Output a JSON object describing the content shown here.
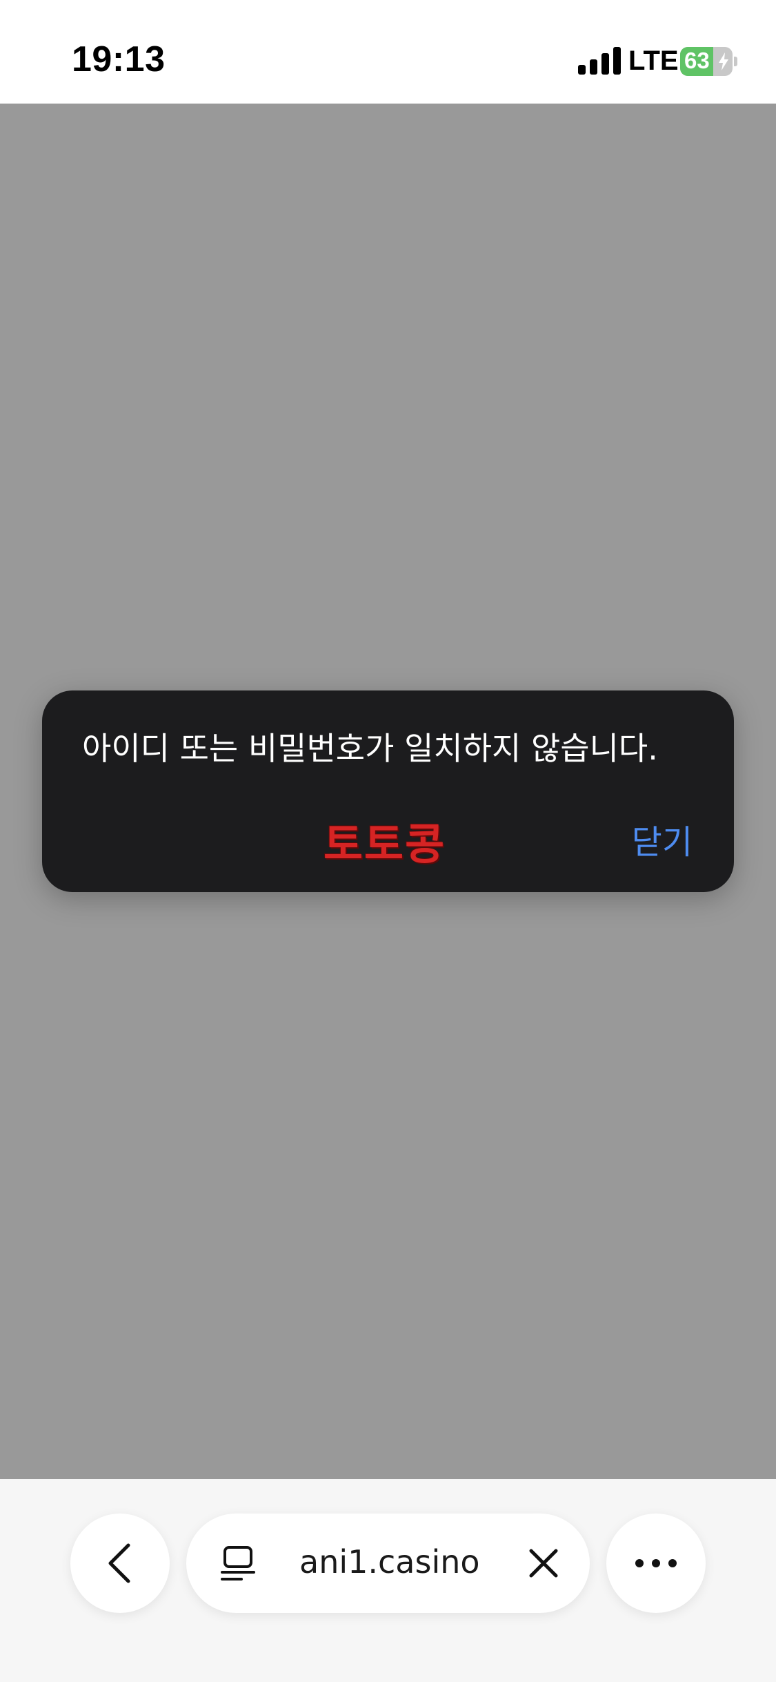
{
  "status_bar": {
    "time": "19:13",
    "network": "LTE",
    "battery_level": "63",
    "battery_percent": 63,
    "battery_color": "#5fc365"
  },
  "alert": {
    "message": "아이디 또는 비밀번호가 일치하지 않습니다.",
    "watermark": "토토콩",
    "close_label": "닫기",
    "close_color": "#4e8cf0",
    "watermark_color": "#d62424"
  },
  "toolbar": {
    "url": "ani1.casino",
    "icons": [
      "chevron-left-icon",
      "tabs-icon",
      "close-icon",
      "more-icon"
    ]
  }
}
